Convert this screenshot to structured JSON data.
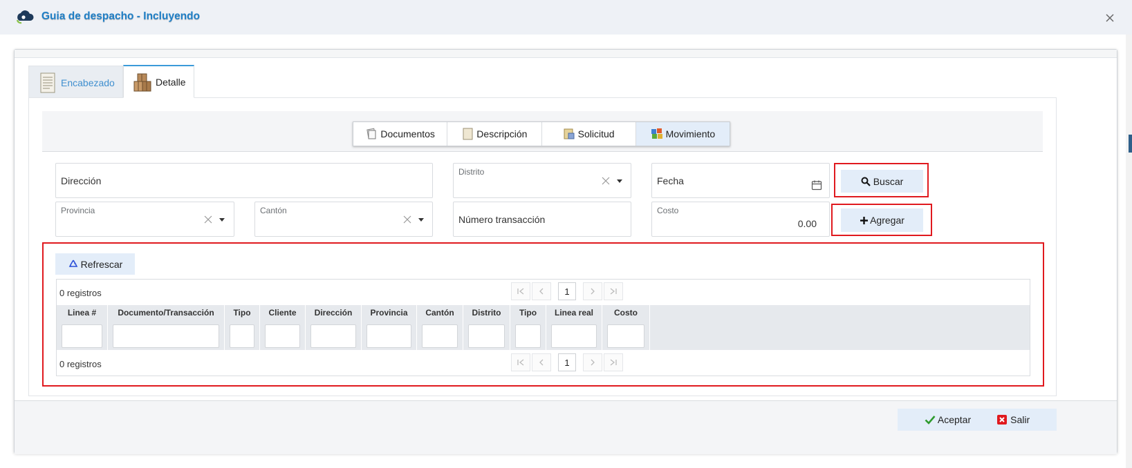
{
  "window": {
    "title": "Guia de despacho - Incluyendo"
  },
  "tabs": [
    {
      "label": "Encabezado"
    },
    {
      "label": "Detalle"
    }
  ],
  "subtabs": [
    {
      "label": "Documentos"
    },
    {
      "label": "Descripción"
    },
    {
      "label": "Solicitud"
    },
    {
      "label": "Movimiento"
    }
  ],
  "form": {
    "direccion": "Dirección",
    "distrito": "Distrito",
    "fecha": "Fecha",
    "provincia": "Provincia",
    "canton": "Cantón",
    "numero_transaccion": "Número transacción",
    "costo_label": "Costo",
    "costo_value": "0.00"
  },
  "buttons": {
    "buscar": "Buscar",
    "agregar": "Agregar",
    "refrescar": "Refrescar",
    "aceptar": "Aceptar",
    "salir": "Salir"
  },
  "grid": {
    "record_count_top": "0 registros",
    "record_count_bottom": "0 registros",
    "current_page": "1",
    "columns": [
      "Linea #",
      "Documento/Transacción",
      "Tipo",
      "Cliente",
      "Dirección",
      "Provincia",
      "Cantón",
      "Distrito",
      "Tipo",
      "Linea real",
      "Costo"
    ]
  },
  "colors": {
    "accent": "#1f7fc6",
    "highlight": "#e0191e",
    "button_bg": "#e3edf9"
  }
}
